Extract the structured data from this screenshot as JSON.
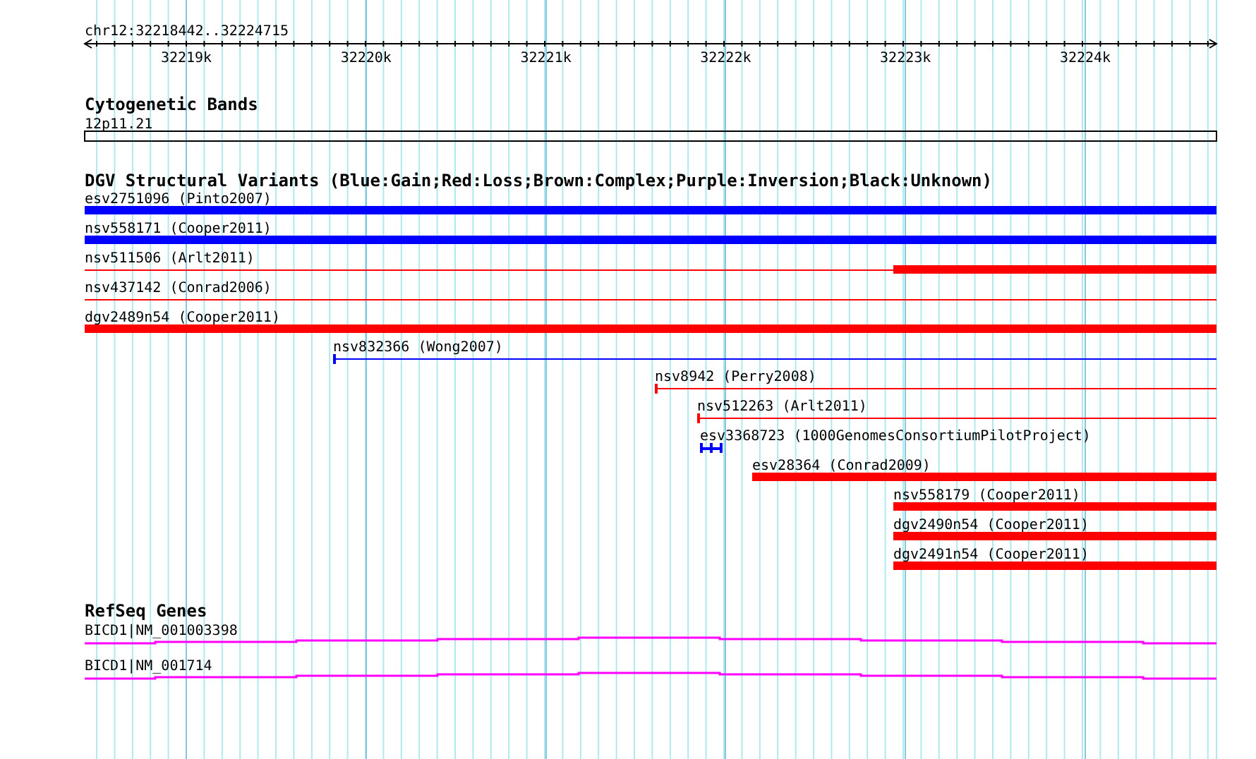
{
  "ruler": {
    "region": "chr12:32218442..32224715",
    "ticks": [
      "32219k",
      "32220k",
      "32221k",
      "32222k",
      "32223k",
      "32224k"
    ]
  },
  "tracks": [
    {
      "kind": "bands",
      "title": "Cytogenetic Bands",
      "features": [
        {
          "label": "12p11.21"
        }
      ]
    },
    {
      "kind": "variants",
      "title": "DGV Structural Variants (Blue:Gain;Red:Loss;Brown:Complex;Purple:Inversion;Black:Unknown)",
      "features": [
        {
          "label": "esv2751096 (Pinto2007)",
          "color": "#0000ff",
          "kind": "bar"
        },
        {
          "label": "nsv558171 (Cooper2011)",
          "color": "#0000ff",
          "kind": "bar"
        },
        {
          "label": "nsv511506 (Arlt2011)",
          "color": "#ff0000",
          "kind": "line"
        },
        {
          "label": "nsv437142 (Conrad2006)",
          "color": "#ff0000",
          "kind": "line"
        },
        {
          "label": "dgv2489n54 (Cooper2011)",
          "color": "#ff0000",
          "kind": "bar"
        },
        {
          "label": "nsv832366 (Wong2007)",
          "color": "#0000ff",
          "kind": "line"
        },
        {
          "label": "nsv8942 (Perry2008)",
          "color": "#ff0000",
          "kind": "line"
        },
        {
          "label": "nsv512263 (Arlt2011)",
          "color": "#ff0000",
          "kind": "line"
        },
        {
          "label": "esv3368723 (1000GenomesConsortiumPilotProject)",
          "color": "#0000ff",
          "kind": "dumbbell"
        },
        {
          "label": "esv28364 (Conrad2009)",
          "color": "#ff0000",
          "kind": "bar"
        },
        {
          "label": "nsv558179 (Cooper2011)",
          "color": "#ff0000",
          "kind": "bar"
        },
        {
          "label": "dgv2490n54 (Cooper2011)",
          "color": "#ff0000",
          "kind": "bar"
        },
        {
          "label": "dgv2491n54 (Cooper2011)",
          "color": "#ff0000",
          "kind": "bar"
        }
      ]
    },
    {
      "kind": "genes",
      "title": "RefSeq Genes",
      "features": [
        {
          "label": "BICD1|NM_001003398"
        },
        {
          "label": "BICD1|NM_001714"
        }
      ]
    }
  ]
}
